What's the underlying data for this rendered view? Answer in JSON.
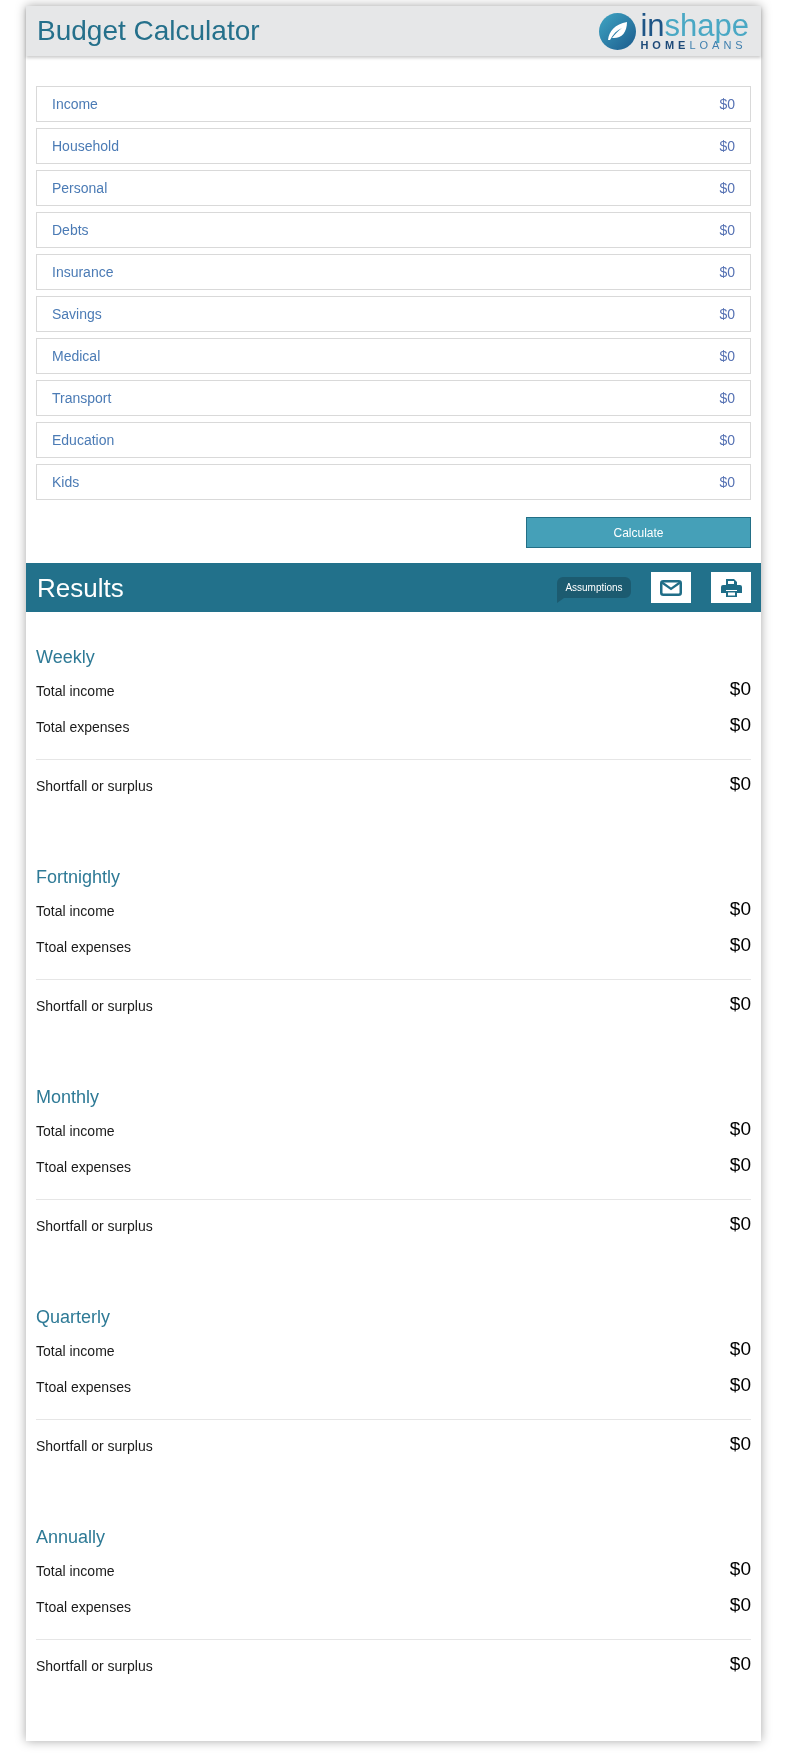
{
  "header": {
    "title": "Budget Calculator",
    "logo": {
      "wordmark": [
        "in",
        "shape"
      ],
      "tagline": [
        "HOME",
        "LOANS"
      ]
    }
  },
  "categories": [
    {
      "label": "Income",
      "amount": "$0"
    },
    {
      "label": "Household",
      "amount": "$0"
    },
    {
      "label": "Personal",
      "amount": "$0"
    },
    {
      "label": "Debts",
      "amount": "$0"
    },
    {
      "label": "Insurance",
      "amount": "$0"
    },
    {
      "label": "Savings",
      "amount": "$0"
    },
    {
      "label": "Medical",
      "amount": "$0"
    },
    {
      "label": "Transport",
      "amount": "$0"
    },
    {
      "label": "Education",
      "amount": "$0"
    },
    {
      "label": "Kids",
      "amount": "$0"
    }
  ],
  "calculate_button": "Calculate",
  "results": {
    "title": "Results",
    "assumptions_button": "Assumptions",
    "periods": [
      {
        "heading": "Weekly",
        "rows": [
          {
            "label": "Total income",
            "amount": "$0"
          },
          {
            "label": "Total expenses",
            "amount": "$0"
          }
        ],
        "result": {
          "label": "Shortfall or surplus",
          "amount": "$0"
        }
      },
      {
        "heading": "Fortnightly",
        "rows": [
          {
            "label": "Total income",
            "amount": "$0"
          },
          {
            "label": "Ttoal expenses",
            "amount": "$0"
          }
        ],
        "result": {
          "label": "Shortfall or surplus",
          "amount": "$0"
        }
      },
      {
        "heading": "Monthly",
        "rows": [
          {
            "label": "Total income",
            "amount": "$0"
          },
          {
            "label": "Ttoal expenses",
            "amount": "$0"
          }
        ],
        "result": {
          "label": "Shortfall or surplus",
          "amount": "$0"
        }
      },
      {
        "heading": "Quarterly",
        "rows": [
          {
            "label": "Total income",
            "amount": "$0"
          },
          {
            "label": "Ttoal expenses",
            "amount": "$0"
          }
        ],
        "result": {
          "label": "Shortfall or surplus",
          "amount": "$0"
        }
      },
      {
        "heading": "Annually",
        "rows": [
          {
            "label": "Total income",
            "amount": "$0"
          },
          {
            "label": "Ttoal expenses",
            "amount": "$0"
          }
        ],
        "result": {
          "label": "Shortfall or surplus",
          "amount": "$0"
        }
      }
    ]
  }
}
